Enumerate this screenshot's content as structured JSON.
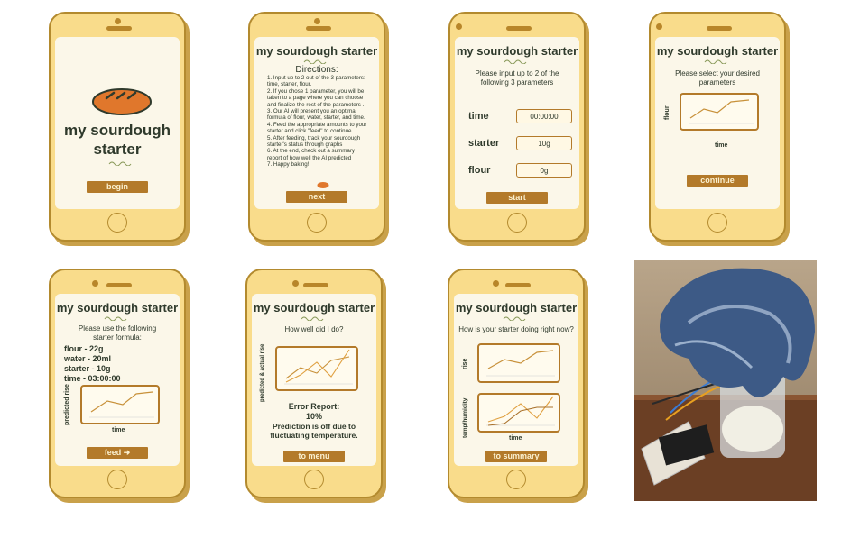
{
  "colors": {
    "phone_body": "#f9dc8b",
    "screen": "#fbf7e9",
    "button": "#b37a2a",
    "text": "#2f3a2c",
    "chart_line": "#c8913a"
  },
  "screen1": {
    "title": "my sourdough starter",
    "button": "begin"
  },
  "screen2": {
    "title": "my sourdough starter",
    "heading": "Directions:",
    "directions": [
      "1. Input up to 2 out of the 3 parameters: time, starter, flour.",
      "2. If you chose 1 parameter, you will be taken to a page where you can choose and finalize the rest of the parameters .",
      "3. Our AI will present you an optimal formula of flour, water, starter, and time.",
      "4. Feed the appropriate amounts to your starter and click \"feed\" to continue",
      "5. After feeding, track your sourdough starter's status through graphs",
      "6. At the end, check out a summary report of how well the AI predicted",
      "7. Happy baking!"
    ],
    "button": "next"
  },
  "screen3": {
    "title": "my sourdough starter",
    "prompt": "Please input up to 2 of the following 3 parameters",
    "fields": [
      {
        "label": "time",
        "value": "00:00:00"
      },
      {
        "label": "starter",
        "value": "10g"
      },
      {
        "label": "flour",
        "value": "0g"
      }
    ],
    "button": "start"
  },
  "screen4": {
    "title": "my sourdough starter",
    "prompt": "Please select your desired parameters",
    "ylabel": "flour",
    "xlabel": "time",
    "button": "continue"
  },
  "screen5": {
    "title": "my sourdough starter",
    "prompt": "Please use the following starter formula:",
    "formula": [
      "flour - 22g",
      "water - 20ml",
      "starter - 10g",
      "time - 03:00:00"
    ],
    "ylabel": "predicted rise",
    "xlabel": "time",
    "button": "feed"
  },
  "screen6": {
    "title": "my sourdough starter",
    "prompt": "How well did I do?",
    "ylabel": "predicted & actual rise",
    "error_title": "Error Report:",
    "error_value": "10%",
    "error_note": "Prediction is off due to fluctuating temperature.",
    "button": "to menu"
  },
  "screen7": {
    "title": "my sourdough starter",
    "prompt": "How is your starter doing right now?",
    "ylabel1": "rise",
    "ylabel2": "temp/humidity",
    "xlabel": "time",
    "button": "to summary"
  }
}
